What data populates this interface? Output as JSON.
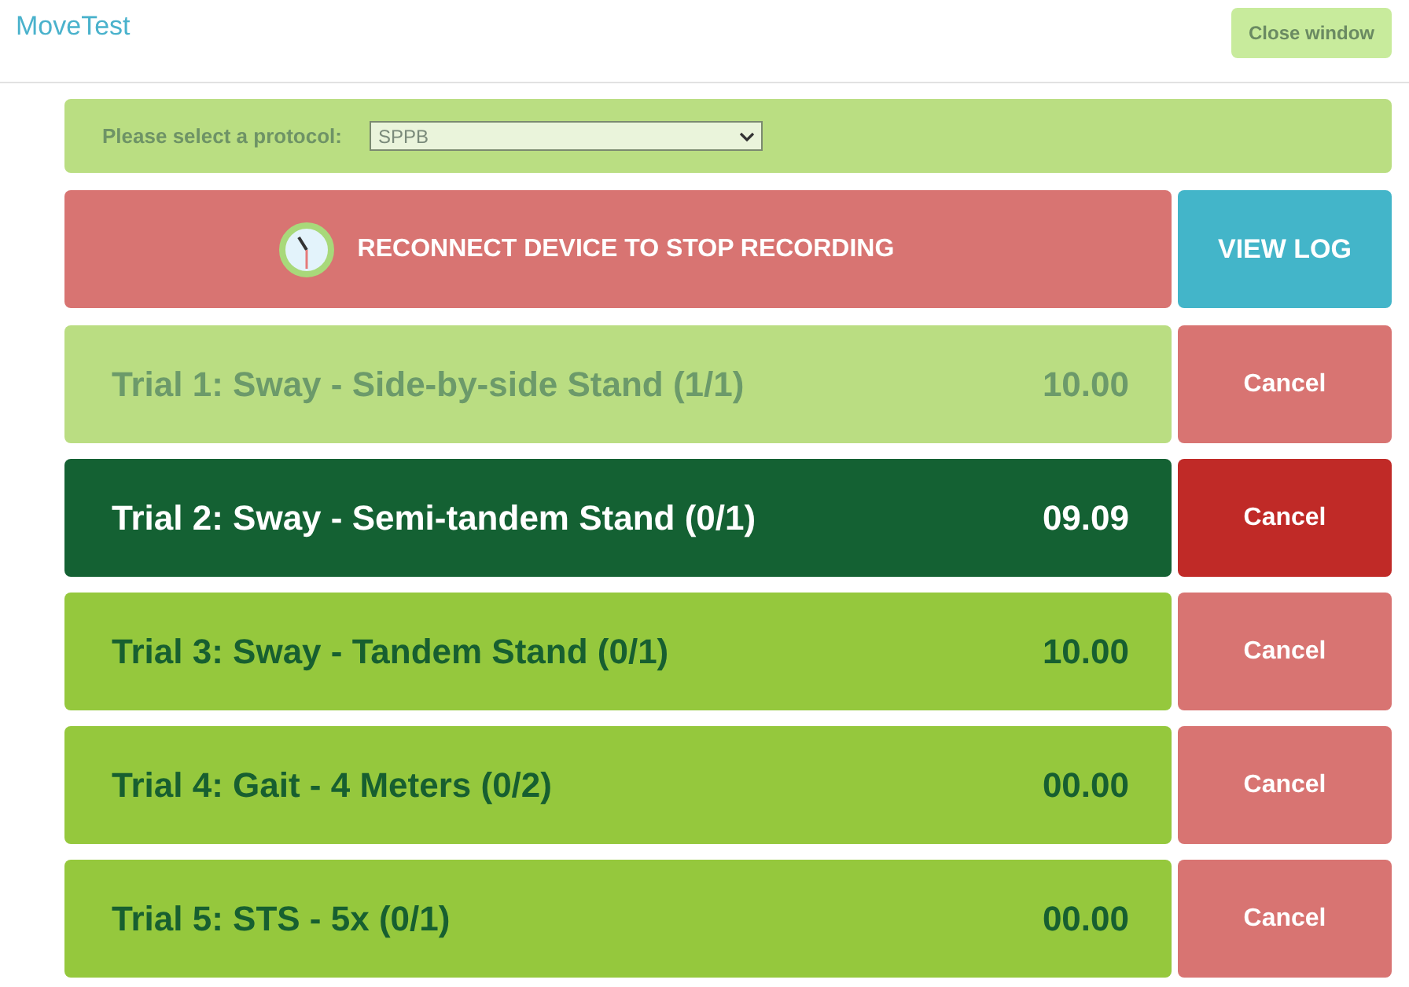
{
  "app_title": "MoveTest",
  "close_button": "Close window",
  "protocol": {
    "label": "Please select a protocol:",
    "value": "SPPB"
  },
  "status_banner": "RECONNECT DEVICE TO STOP RECORDING",
  "log_button": "VIEW LOG",
  "trials": [
    {
      "title": "Trial 1: Sway - Side-by-side Stand (1/1)",
      "time": "10.00",
      "kind": "done",
      "cancel": "Cancel"
    },
    {
      "title": "Trial 2: Sway - Semi-tandem Stand (0/1)",
      "time": "09.09",
      "kind": "active",
      "cancel": "Cancel"
    },
    {
      "title": "Trial 3: Sway - Tandem Stand (0/1)",
      "time": "10.00",
      "kind": "pending",
      "cancel": "Cancel"
    },
    {
      "title": "Trial 4: Gait - 4 Meters (0/2)",
      "time": "00.00",
      "kind": "pending",
      "cancel": "Cancel"
    },
    {
      "title": "Trial 5: STS - 5x (0/1)",
      "time": "00.00",
      "kind": "pending",
      "cancel": "Cancel"
    }
  ]
}
